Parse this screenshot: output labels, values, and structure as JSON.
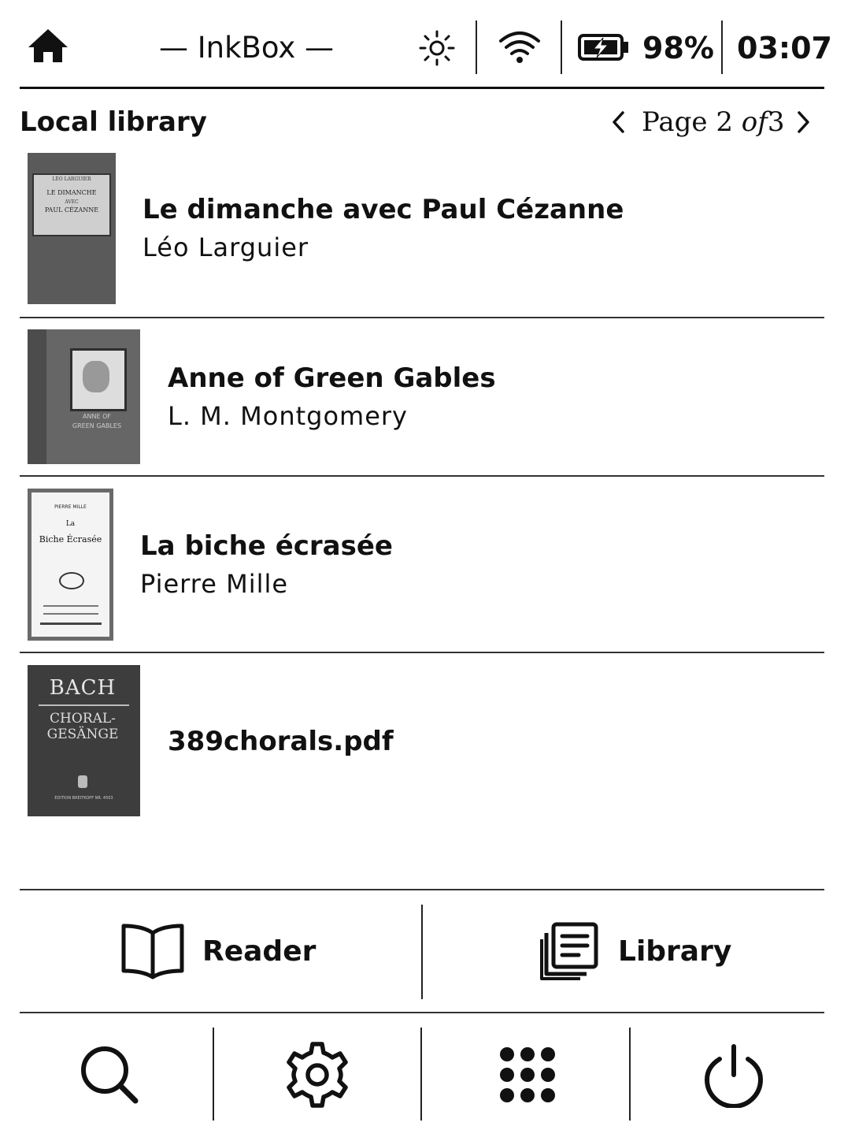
{
  "app": {
    "title": "— InkBox —"
  },
  "status": {
    "battery_percent": "98%",
    "time": "03:07",
    "brightness_icon": "brightness-icon",
    "wifi_icon": "wifi-icon",
    "battery_icon": "battery-charging-icon"
  },
  "library": {
    "title": "Local library",
    "pager": {
      "prefix": "Page",
      "current": "2",
      "of": "of",
      "total": "3"
    }
  },
  "books": [
    {
      "title": "Le dimanche avec Paul Cézanne",
      "author": "Léo Larguier",
      "cover": {
        "style": "label",
        "lines": [
          "LÉO LARGUIER",
          "LE DIMANCHE",
          "AVEC",
          "PAUL CÉZANNE"
        ]
      }
    },
    {
      "title": "Anne of Green Gables",
      "author": "L. M. Montgomery",
      "cover": {
        "style": "framed-illustration",
        "lines": [
          "ANNE OF",
          "GREEN GABLES"
        ]
      }
    },
    {
      "title": "La biche écrasée",
      "author": "Pierre Mille",
      "cover": {
        "style": "title-page",
        "lines": [
          "PIERRE MILLE",
          "La",
          "Biche Écrasée"
        ]
      }
    },
    {
      "title": "389chorals.pdf",
      "author": "",
      "cover": {
        "style": "dark-title",
        "lines": [
          "BACH",
          "CHORAL-",
          "GESÄNGE",
          "EDITION BREITKOPF NR. 4503"
        ]
      }
    }
  ],
  "modes": {
    "reader_label": "Reader",
    "library_label": "Library"
  },
  "toolbar": {
    "search_icon": "search-icon",
    "settings_icon": "gear-icon",
    "apps_icon": "apps-grid-icon",
    "power_icon": "power-icon"
  }
}
